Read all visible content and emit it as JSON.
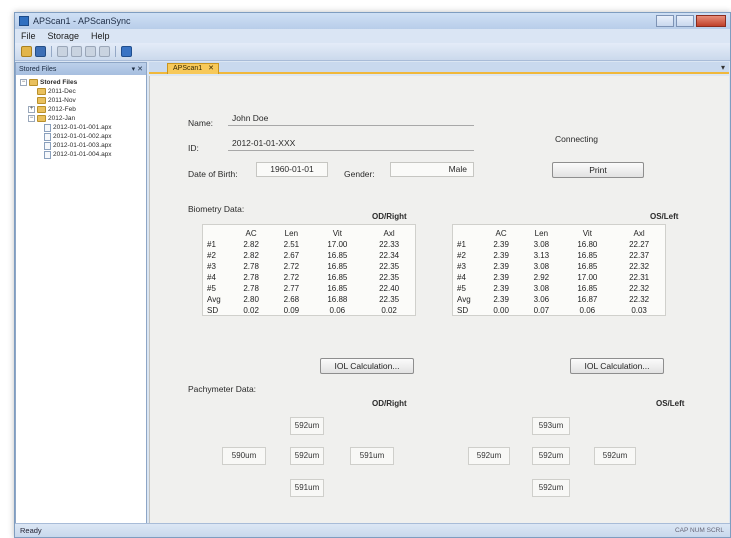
{
  "window": {
    "title": "APScan1 - APScanSync",
    "menu": [
      "File",
      "Storage",
      "Help"
    ]
  },
  "tree_panel": {
    "header": "Stored Files",
    "items": [
      {
        "label": "Stored Files",
        "level": 0,
        "type": "folder",
        "expanded": true
      },
      {
        "label": "2011-Dec",
        "level": 1,
        "type": "folder"
      },
      {
        "label": "2011-Nov",
        "level": 1,
        "type": "folder"
      },
      {
        "label": "2012-Feb",
        "level": 1,
        "type": "folder"
      },
      {
        "label": "2012-Jan",
        "level": 1,
        "type": "folder",
        "expanded": true
      },
      {
        "label": "2012-01-01-001.apx",
        "level": 2,
        "type": "file"
      },
      {
        "label": "2012-01-01-002.apx",
        "level": 2,
        "type": "file"
      },
      {
        "label": "2012-01-01-003.apx",
        "level": 2,
        "type": "file"
      },
      {
        "label": "2012-01-01-004.apx",
        "level": 2,
        "type": "file"
      }
    ]
  },
  "document": {
    "tab_label": "APScan1",
    "patient": {
      "name_label": "Name:",
      "name_value": "John Doe",
      "id_label": "ID:",
      "id_value": "2012-01-01-XXX",
      "dob_label": "Date of Birth:",
      "dob_value": "1960-01-01",
      "gender_label": "Gender:",
      "gender_value": "Male"
    },
    "status_text": "Connecting",
    "print_label": "Print",
    "biometry": {
      "section_label": "Biometry Data:",
      "right_label": "OD/Right",
      "left_label": "OS/Left",
      "columns": [
        "",
        "AC",
        "Len",
        "Vit",
        "Axl"
      ],
      "right_rows": [
        [
          "#1",
          "2.82",
          "2.51",
          "17.00",
          "22.33"
        ],
        [
          "#2",
          "2.82",
          "2.67",
          "16.85",
          "22.34"
        ],
        [
          "#3",
          "2.78",
          "2.72",
          "16.85",
          "22.35"
        ],
        [
          "#4",
          "2.78",
          "2.72",
          "16.85",
          "22.35"
        ],
        [
          "#5",
          "2.78",
          "2.77",
          "16.85",
          "22.40"
        ],
        [
          "Avg",
          "2.80",
          "2.68",
          "16.88",
          "22.35"
        ],
        [
          "SD",
          "0.02",
          "0.09",
          "0.06",
          "0.02"
        ]
      ],
      "left_rows": [
        [
          "#1",
          "2.39",
          "3.08",
          "16.80",
          "22.27"
        ],
        [
          "#2",
          "2.39",
          "3.13",
          "16.85",
          "22.37"
        ],
        [
          "#3",
          "2.39",
          "3.08",
          "16.85",
          "22.32"
        ],
        [
          "#4",
          "2.39",
          "2.92",
          "17.00",
          "22.31"
        ],
        [
          "#5",
          "2.39",
          "3.08",
          "16.85",
          "22.32"
        ],
        [
          "Avg",
          "2.39",
          "3.06",
          "16.87",
          "22.32"
        ],
        [
          "SD",
          "0.00",
          "0.07",
          "0.06",
          "0.03"
        ]
      ],
      "iol_button_label": "IOL Calculation..."
    },
    "pachymeter": {
      "section_label": "Pachymeter Data:",
      "right_label": "OD/Right",
      "left_label": "OS/Left",
      "right": {
        "top": "592um",
        "left": "590um",
        "center": "592um",
        "right": "591um",
        "bottom": "591um"
      },
      "left": {
        "top": "593um",
        "left": "592um",
        "center": "592um",
        "right": "592um",
        "bottom": "592um"
      }
    }
  },
  "statusbar": {
    "text": "Ready",
    "right_text": "CAP NUM SCRL"
  },
  "colors": {
    "accent_tab": "#f7c95a",
    "frame_blue": "#dbe6f3"
  }
}
